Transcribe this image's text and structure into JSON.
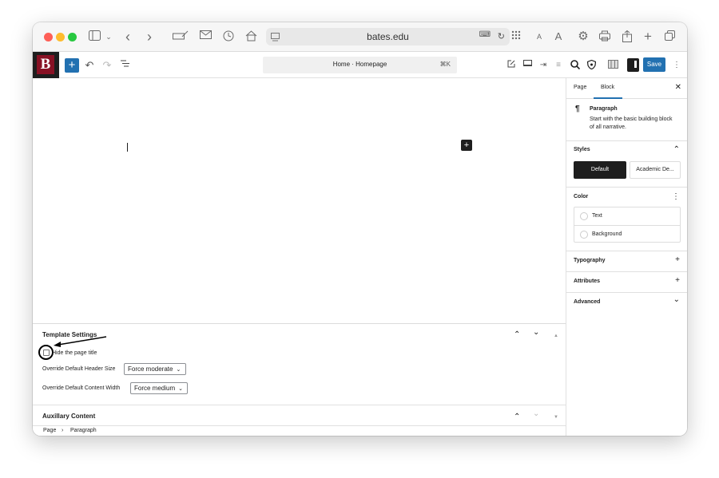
{
  "browser": {
    "url": "bates.edu"
  },
  "header": {
    "logo_letter": "B",
    "add_label": "+",
    "document_title": "Home · Homepage",
    "shortcut": "⌘K",
    "save_label": "Save"
  },
  "template_settings": {
    "title": "Template Settings",
    "hide_title_label": "Hide the page title",
    "header_size_label": "Override Default Header Size",
    "header_size_value": "Force moderate",
    "content_width_label": "Override Default Content Width",
    "content_width_value": "Force medium"
  },
  "auxiliary": {
    "title": "Auxillary Content"
  },
  "breadcrumb": {
    "items": [
      "Page",
      "Paragraph"
    ],
    "separator": "›"
  },
  "sidebar": {
    "tabs": [
      "Page",
      "Block"
    ],
    "active_tab": "Block",
    "block": {
      "name": "Paragraph",
      "description": "Start with the basic building block of all narrative."
    },
    "styles": {
      "title": "Styles",
      "options": [
        "Default",
        "Academic De..."
      ]
    },
    "color": {
      "title": "Color",
      "items": [
        "Text",
        "Background"
      ]
    },
    "panels": [
      "Typography",
      "Attributes",
      "Advanced"
    ]
  },
  "colors": {
    "accent": "#2271b1",
    "brand": "#881124",
    "dark": "#1e1e1e"
  }
}
